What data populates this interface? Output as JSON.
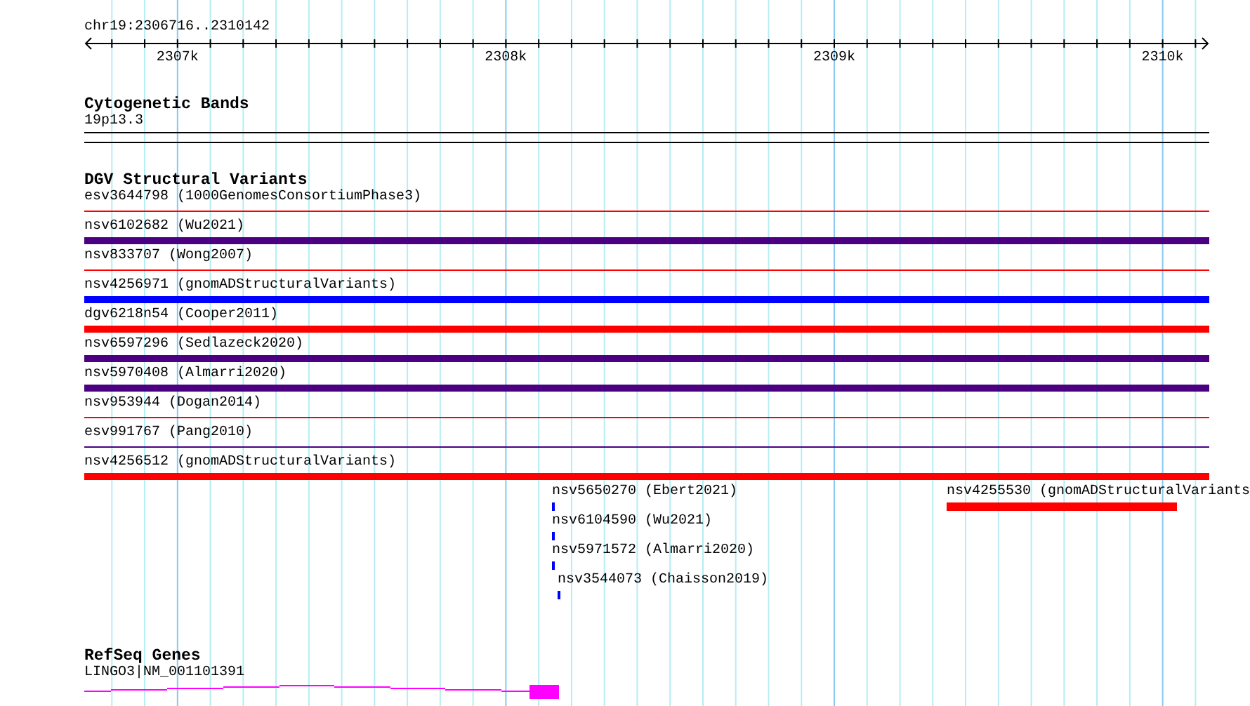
{
  "ruler": {
    "location": "chr19:2306716..2310142",
    "ticks": [
      "2307k",
      "2308k",
      "2309k",
      "2310k"
    ]
  },
  "tracks": [
    {
      "kind": "bands",
      "title": "Cytogenetic Bands",
      "features": [
        {
          "label": "19p13.3"
        }
      ]
    },
    {
      "kind": "variants",
      "title": "DGV Structural Variants",
      "features": [
        {
          "label": "esv3644798 (1000GenomesConsortiumPhase3)",
          "kind": "thin",
          "color": "#ff0000"
        },
        {
          "label": "nsv6102682 (Wu2021)",
          "kind": "thick",
          "color": "#4b0082"
        },
        {
          "label": "nsv833707 (Wong2007)",
          "kind": "thin",
          "color": "#ff0000"
        },
        {
          "label": "nsv4256971 (gnomADStructuralVariants)",
          "kind": "thick",
          "color": "#0000ff"
        },
        {
          "label": "dgv6218n54 (Cooper2011)",
          "kind": "thick",
          "color": "#ff0000"
        },
        {
          "label": "nsv6597296 (Sedlazeck2020)",
          "kind": "thick",
          "color": "#4b0082"
        },
        {
          "label": "nsv5970408 (Almarri2020)",
          "kind": "thick",
          "color": "#4b0082"
        },
        {
          "label": "nsv953944 (Dogan2014)",
          "kind": "thin",
          "color": "#ff0000"
        },
        {
          "label": "esv991767 (Pang2010)",
          "kind": "thin",
          "color": "#4b0082"
        },
        {
          "label": "nsv4256512 (gnomADStructuralVariants)",
          "kind": "thick",
          "color": "#ff0000"
        }
      ],
      "local_features": [
        {
          "label": "nsv5650270 (Ebert2021)",
          "color": "#0000ff"
        },
        {
          "label": "nsv6104590 (Wu2021)",
          "color": "#0000ff"
        },
        {
          "label": "nsv5971572 (Almarri2020)",
          "color": "#0000ff"
        },
        {
          "label": "nsv3544073 (Chaisson2019)",
          "color": "#0000ff"
        },
        {
          "label": "nsv4255530 (gnomADStructuralVariants",
          "color": "#ff0000"
        }
      ]
    },
    {
      "kind": "genes",
      "title": "RefSeq Genes",
      "features": [
        {
          "label": "LINGO3|NM_001101391",
          "color": "#ff00ff"
        }
      ]
    }
  ]
}
